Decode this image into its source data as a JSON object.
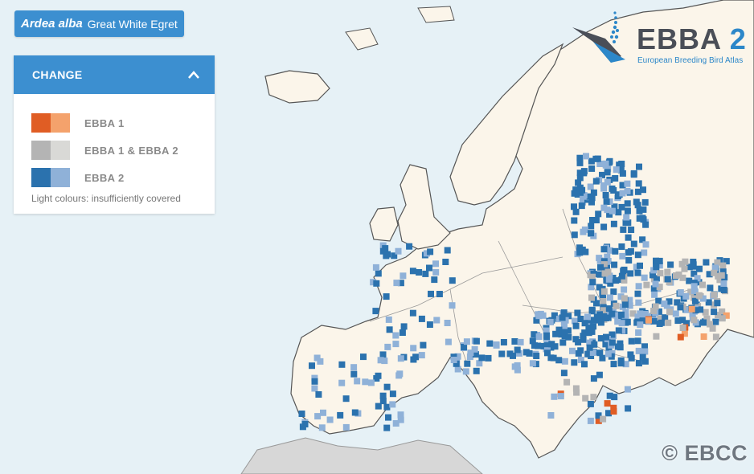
{
  "species": {
    "latin": "Ardea alba",
    "common": "Great White Egret"
  },
  "legend": {
    "title": "CHANGE",
    "items": [
      {
        "label": "EBBA 1",
        "colors": [
          "#e05d24",
          "#f4a26c"
        ]
      },
      {
        "label": "EBBA 1 & EBBA 2",
        "colors": [
          "#b4b4b4",
          "#d9d9d6"
        ]
      },
      {
        "label": "EBBA 2",
        "colors": [
          "#2b72ae",
          "#8fb1d8"
        ]
      }
    ],
    "note": "Light colours: insufficiently covered"
  },
  "logo": {
    "main": "EBBA",
    "number": "2",
    "subtitle": "European Breeding Bird Atlas"
  },
  "copyright": "© EBCC",
  "map_colors": {
    "sea": "#e6f1f6",
    "land": "#fbf5ea",
    "outside": "#d6d6d6",
    "border": "#555555"
  }
}
